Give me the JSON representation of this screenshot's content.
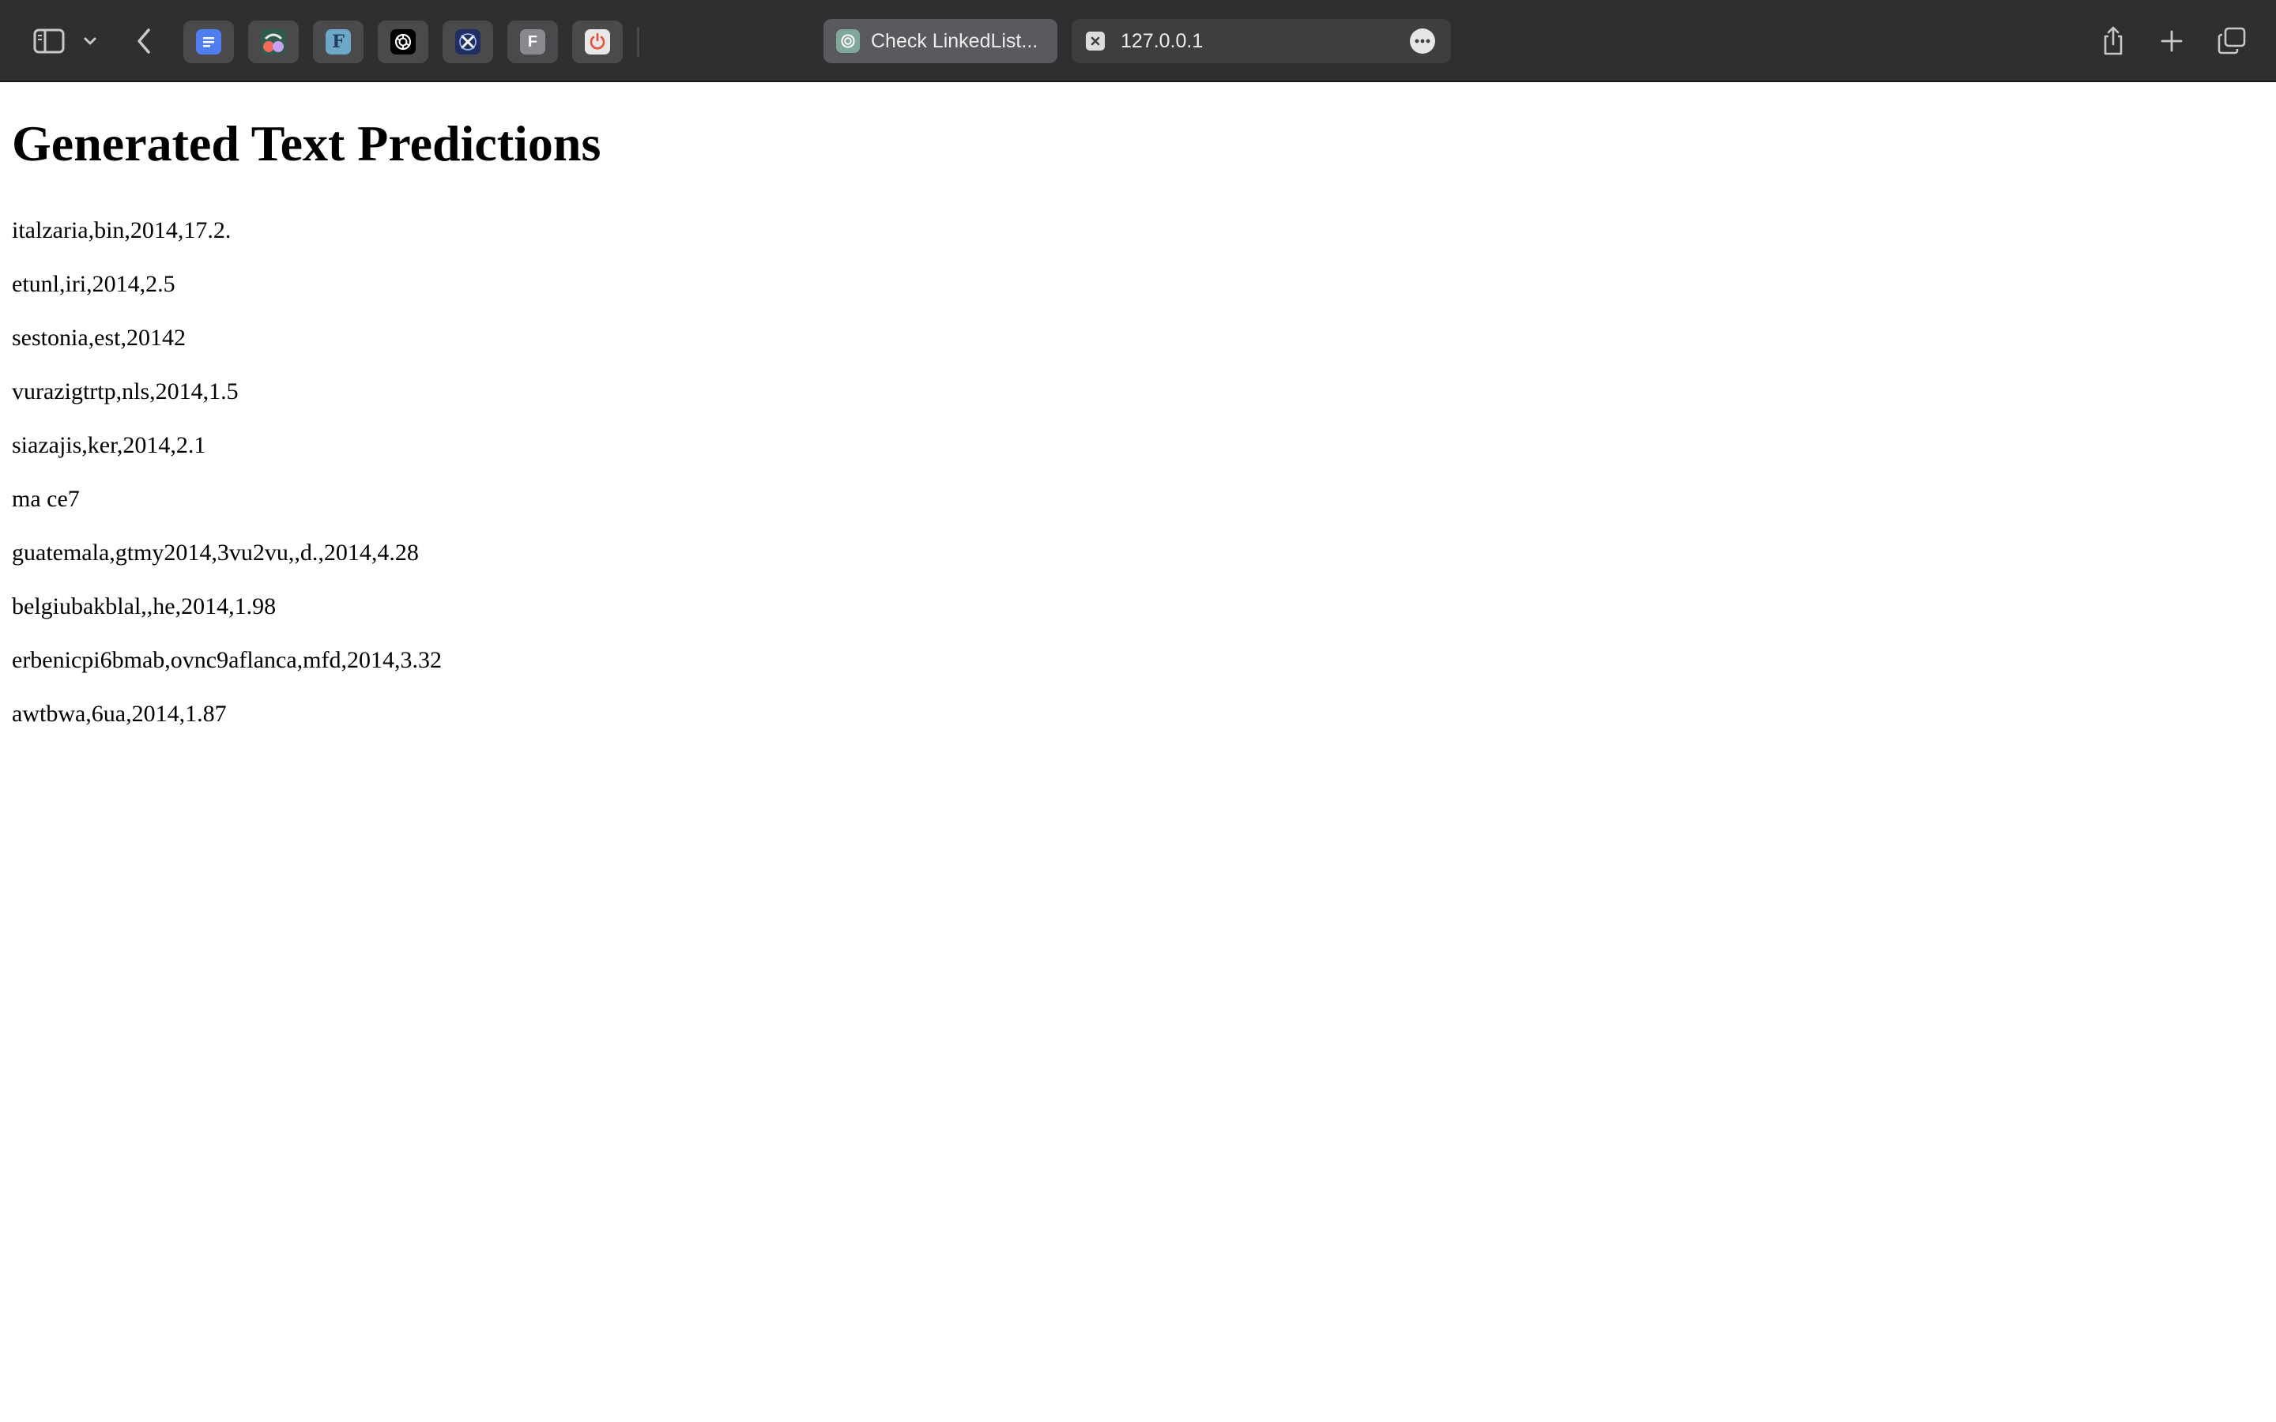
{
  "browser": {
    "tabs": [
      {
        "label": "Check LinkedList...",
        "icon": "chatgpt-icon"
      },
      {
        "label": "127.0.0.1",
        "icon": "close-icon"
      }
    ],
    "favorites": [
      {
        "name": "docs-icon",
        "color": "#4f7ef0"
      },
      {
        "name": "app-icon",
        "color": "#2e5b4e"
      },
      {
        "name": "f-blue-icon",
        "color": "#6ea8c8",
        "letter": "F"
      },
      {
        "name": "chatgpt-icon",
        "color": "#000000"
      },
      {
        "name": "x-app-icon",
        "color": "#1e2f60"
      },
      {
        "name": "f-gray-icon",
        "color": "#8a8a8e",
        "letter": "F"
      },
      {
        "name": "power-icon",
        "color": "#e8e8e8"
      }
    ],
    "colors": {
      "toolbar_bg": "#2f2f31",
      "active_tab_bg": "#5a5a5e",
      "url_tab_bg": "#3e3e41"
    }
  },
  "page": {
    "title": "Generated Text Predictions",
    "lines": [
      "italzaria,bin,2014,17.2.",
      "etunl,iri,2014,2.5",
      "sestonia,est,20142",
      "vurazigtrtp,nls,2014,1.5",
      "siazajis,ker,2014,2.1",
      "ma ce7",
      "guatemala,gtmy2014,3vu2vu,,d.,2014,4.28",
      "belgiubakblal,,he,2014,1.98",
      "erbenicpi6bmab,ovnc9aflanca,mfd,2014,3.32",
      "awtbwa,6ua,2014,1.87"
    ]
  }
}
